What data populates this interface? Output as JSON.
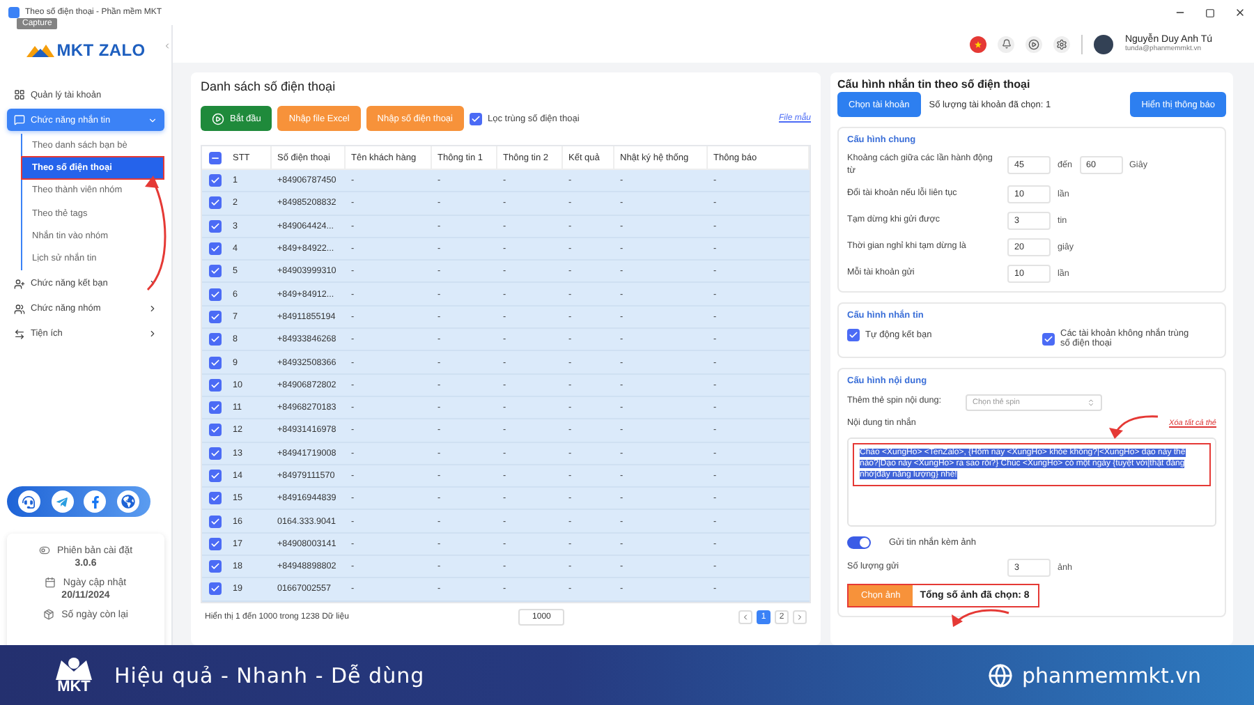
{
  "window": {
    "title": "Theo số điện thoại - Phần mềm MKT",
    "capture_badge": "Capture"
  },
  "header": {
    "user_name": "Nguyễn Duy Anh Tú",
    "user_email": "tunda@phanmemmkt.vn"
  },
  "sidebar": {
    "logo": "MKT ZALO",
    "items": [
      {
        "label": "Quản lý tài khoản",
        "kind": "link",
        "selected": false
      },
      {
        "label": "Chức năng nhắn tin",
        "kind": "group",
        "selected": true,
        "expanded": true,
        "children": [
          {
            "label": "Theo danh sách bạn bè",
            "selected": false,
            "highlighted": false
          },
          {
            "label": "Theo số điện thoại",
            "selected": true,
            "highlighted": true
          },
          {
            "label": "Theo thành viên nhóm",
            "selected": false,
            "highlighted": false
          },
          {
            "label": "Theo thẻ tags",
            "selected": false,
            "highlighted": false
          },
          {
            "label": "Nhắn tin vào nhóm",
            "selected": false,
            "highlighted": false
          },
          {
            "label": "Lịch sử nhắn tin",
            "selected": false,
            "highlighted": false
          }
        ]
      },
      {
        "label": "Chức năng kết bạn",
        "kind": "group",
        "selected": false,
        "expanded": false
      },
      {
        "label": "Chức năng nhóm",
        "kind": "group",
        "selected": false,
        "expanded": false
      },
      {
        "label": "Tiện ích",
        "kind": "group",
        "selected": false,
        "expanded": false
      }
    ],
    "info": [
      {
        "label": "Phiên bản cài đặt",
        "value": "3.0.6"
      },
      {
        "label": "Ngày cập nhật",
        "value": "20/11/2024"
      },
      {
        "label": "Số ngày còn lại"
      }
    ]
  },
  "list_panel": {
    "title": "Danh sách số điện thoại",
    "buttons": [
      {
        "label": "Bắt đầu",
        "kind": "start"
      },
      {
        "label": "Nhập file Excel",
        "kind": "import"
      },
      {
        "label": "Nhập số điện thoại",
        "kind": "import"
      }
    ],
    "dedupe": {
      "label": "Lọc trùng số điện thoại",
      "checked": true
    },
    "sample_link": "File mẫu",
    "table": {
      "select_all_partial": true,
      "columns": [
        "STT",
        "Số điện thoại",
        "Tên khách hàng",
        "Thông tin 1",
        "Thông tin 2",
        "Kết quả",
        "Nhật ký hệ thống",
        "Thông báo"
      ],
      "rows": [
        {
          "checked": true,
          "cells": [
            "1",
            "+84906787450",
            "-",
            "-",
            "-",
            "-",
            "-",
            "-"
          ]
        },
        {
          "checked": true,
          "cells": [
            "2",
            "+84985208832",
            "-",
            "-",
            "-",
            "-",
            "-",
            "-"
          ]
        },
        {
          "checked": true,
          "cells": [
            "3",
            "+849064424...",
            "-",
            "-",
            "-",
            "-",
            "-",
            "-"
          ]
        },
        {
          "checked": true,
          "cells": [
            "4",
            "+849+84922...",
            "-",
            "-",
            "-",
            "-",
            "-",
            "-"
          ]
        },
        {
          "checked": true,
          "cells": [
            "5",
            "+84903999310",
            "-",
            "-",
            "-",
            "-",
            "-",
            "-"
          ]
        },
        {
          "checked": true,
          "cells": [
            "6",
            "+849+84912...",
            "-",
            "-",
            "-",
            "-",
            "-",
            "-"
          ]
        },
        {
          "checked": true,
          "cells": [
            "7",
            "+84911855194",
            "-",
            "-",
            "-",
            "-",
            "-",
            "-"
          ]
        },
        {
          "checked": true,
          "cells": [
            "8",
            "+84933846268",
            "-",
            "-",
            "-",
            "-",
            "-",
            "-"
          ]
        },
        {
          "checked": true,
          "cells": [
            "9",
            "+84932508366",
            "-",
            "-",
            "-",
            "-",
            "-",
            "-"
          ]
        },
        {
          "checked": true,
          "cells": [
            "10",
            "+84906872802",
            "-",
            "-",
            "-",
            "-",
            "-",
            "-"
          ]
        },
        {
          "checked": true,
          "cells": [
            "11",
            "+84968270183",
            "-",
            "-",
            "-",
            "-",
            "-",
            "-"
          ]
        },
        {
          "checked": true,
          "cells": [
            "12",
            "+84931416978",
            "-",
            "-",
            "-",
            "-",
            "-",
            "-"
          ]
        },
        {
          "checked": true,
          "cells": [
            "13",
            "+84941719008",
            "-",
            "-",
            "-",
            "-",
            "-",
            "-"
          ]
        },
        {
          "checked": true,
          "cells": [
            "14",
            "+84979111570",
            "-",
            "-",
            "-",
            "-",
            "-",
            "-"
          ]
        },
        {
          "checked": true,
          "cells": [
            "15",
            "+84916944839",
            "-",
            "-",
            "-",
            "-",
            "-",
            "-"
          ]
        },
        {
          "checked": true,
          "cells": [
            "16",
            "0164.333.9041",
            "-",
            "-",
            "-",
            "-",
            "-",
            "-"
          ]
        },
        {
          "checked": true,
          "cells": [
            "17",
            "+84908003141",
            "-",
            "-",
            "-",
            "-",
            "-",
            "-"
          ]
        },
        {
          "checked": true,
          "cells": [
            "18",
            "+84948898802",
            "-",
            "-",
            "-",
            "-",
            "-",
            "-"
          ]
        },
        {
          "checked": true,
          "cells": [
            "19",
            "01667002557",
            "-",
            "-",
            "-",
            "-",
            "-",
            "-"
          ]
        }
      ]
    },
    "footer": {
      "summary": "Hiển thị 1 đến 1000 trong 1238 Dữ liệu",
      "page_size": "1000",
      "pages": [
        {
          "label": "1",
          "selected": true
        },
        {
          "label": "2",
          "selected": false
        }
      ]
    }
  },
  "config_panel": {
    "title": "Cấu hình nhắn tin theo số điện thoại",
    "choose_account": "Chọn tài khoản",
    "account_count": "Số lượng tài khoản đã chọn: 1",
    "show_notice": "Hiển thị thông báo",
    "general": {
      "title": "Cấu hình chung",
      "rows": [
        {
          "label": "Khoảng cách giữa các lần hành động từ",
          "fields": [
            "45",
            "60"
          ],
          "between": "đến",
          "unit": "Giây"
        },
        {
          "label": "Đổi tài khoản nếu lỗi liên tục",
          "fields": [
            "10"
          ],
          "unit": "lần"
        },
        {
          "label": "Tạm dừng khi gửi được",
          "fields": [
            "3"
          ],
          "unit": "tin"
        },
        {
          "label": "Thời gian nghỉ khi tạm dừng là",
          "fields": [
            "20"
          ],
          "unit": "giây"
        },
        {
          "label": "Mỗi tài khoản gửi",
          "fields": [
            "10"
          ],
          "unit": "lần"
        }
      ]
    },
    "messaging": {
      "title": "Cấu hình nhắn tin",
      "options": [
        {
          "label": "Tự động kết bạn",
          "checked": true
        },
        {
          "label": "Các tài khoản không nhắn trùng số điện thoại",
          "checked": true
        }
      ]
    },
    "content": {
      "title": "Cấu hình nội dung",
      "spin_label": "Thêm thẻ spin nội dung:",
      "spin_placeholder": "Chọn thẻ spin",
      "message_label": "Nội dung tin nhắn",
      "clear_link": "Xóa tất cả thẻ",
      "message": "Chào <XungHo> <TenZalo>, {Hôm nay <XungHo> khỏe không?|<XungHo> dạo này thế nào?|Dạo này <XungHo> ra sao rồi?} Chúc <XungHo> có một ngày {tuyệt vời|thật đáng nhớ|đầy năng lượng} nhé!",
      "message_selected": true,
      "message_highlighted": true,
      "attach": {
        "label": "Gửi tin nhắn kèm ảnh",
        "on": true
      },
      "count": {
        "label": "Số lượng gửi",
        "value": "3",
        "unit": "ảnh"
      },
      "choose_image": "Chọn ảnh",
      "image_total": "Tổng số ảnh đã chọn: 8",
      "image_highlighted": true
    }
  },
  "banner": {
    "logo": "MKT",
    "slogan": "Hiệu quả - Nhanh - Dễ dùng",
    "website": "phanmemmkt.vn"
  }
}
